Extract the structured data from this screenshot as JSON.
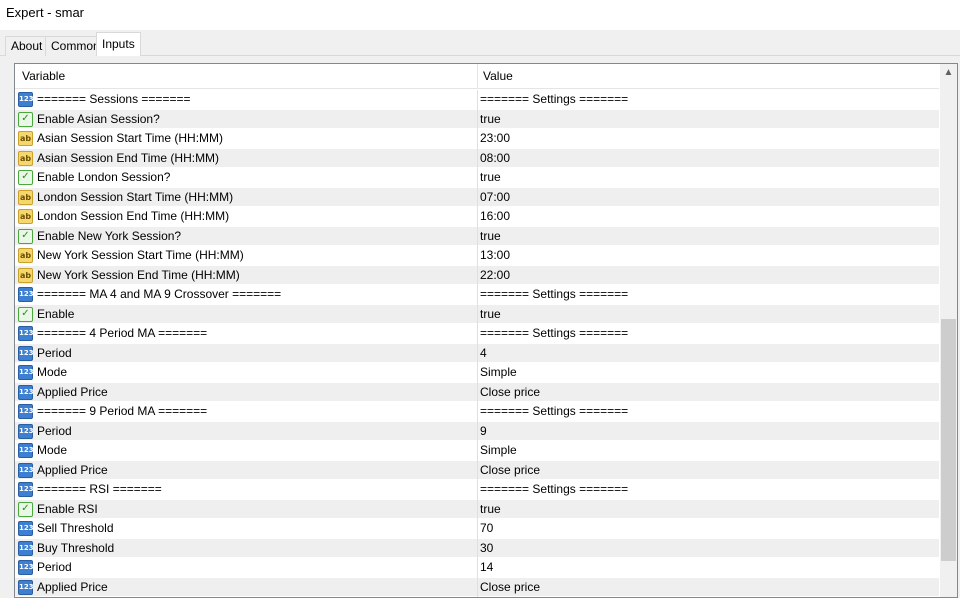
{
  "window": {
    "title": "Expert - smar"
  },
  "tabs": [
    {
      "label": "About"
    },
    {
      "label": "Common"
    },
    {
      "label": "Inputs"
    }
  ],
  "columns": {
    "variable": "Variable",
    "value": "Value"
  },
  "icons": {
    "int": "123",
    "bool": "✓",
    "str": "ab"
  },
  "rows": [
    {
      "icon": "int-icon",
      "name": "======= Sessions =======",
      "value": "======= Settings ======="
    },
    {
      "icon": "bool-icon",
      "name": "Enable Asian Session?",
      "value": "true"
    },
    {
      "icon": "string-icon",
      "name": "Asian Session Start Time (HH:MM)",
      "value": "23:00"
    },
    {
      "icon": "string-icon",
      "name": "Asian Session End Time (HH:MM)",
      "value": "08:00"
    },
    {
      "icon": "bool-icon",
      "name": "Enable London Session?",
      "value": "true"
    },
    {
      "icon": "string-icon",
      "name": "London Session Start Time (HH:MM)",
      "value": "07:00"
    },
    {
      "icon": "string-icon",
      "name": "London Session End Time (HH:MM)",
      "value": "16:00"
    },
    {
      "icon": "bool-icon",
      "name": "Enable New York Session?",
      "value": "true"
    },
    {
      "icon": "string-icon",
      "name": "New York Session Start Time (HH:MM)",
      "value": "13:00"
    },
    {
      "icon": "string-icon",
      "name": "New York Session End Time (HH:MM)",
      "value": "22:00"
    },
    {
      "icon": "int-icon",
      "name": "======= MA 4 and MA 9 Crossover =======",
      "value": "======= Settings ======="
    },
    {
      "icon": "bool-icon",
      "name": "Enable",
      "value": "true"
    },
    {
      "icon": "int-icon",
      "name": "======= 4 Period MA =======",
      "value": "======= Settings ======="
    },
    {
      "icon": "int-icon",
      "name": "Period",
      "value": "4"
    },
    {
      "icon": "int-icon",
      "name": "Mode",
      "value": "Simple"
    },
    {
      "icon": "int-icon",
      "name": "Applied Price",
      "value": "Close price"
    },
    {
      "icon": "int-icon",
      "name": "======= 9 Period MA =======",
      "value": "======= Settings ======="
    },
    {
      "icon": "int-icon",
      "name": "Period",
      "value": "9"
    },
    {
      "icon": "int-icon",
      "name": "Mode",
      "value": "Simple"
    },
    {
      "icon": "int-icon",
      "name": "Applied Price",
      "value": "Close price"
    },
    {
      "icon": "int-icon",
      "name": "======= RSI =======",
      "value": "======= Settings ======="
    },
    {
      "icon": "bool-icon",
      "name": "Enable RSI",
      "value": "true"
    },
    {
      "icon": "int-icon",
      "name": "Sell Threshold",
      "value": "70"
    },
    {
      "icon": "int-icon",
      "name": "Buy Threshold",
      "value": "30"
    },
    {
      "icon": "int-icon",
      "name": "Period",
      "value": "14"
    },
    {
      "icon": "int-icon",
      "name": "Applied Price",
      "value": "Close price"
    }
  ]
}
